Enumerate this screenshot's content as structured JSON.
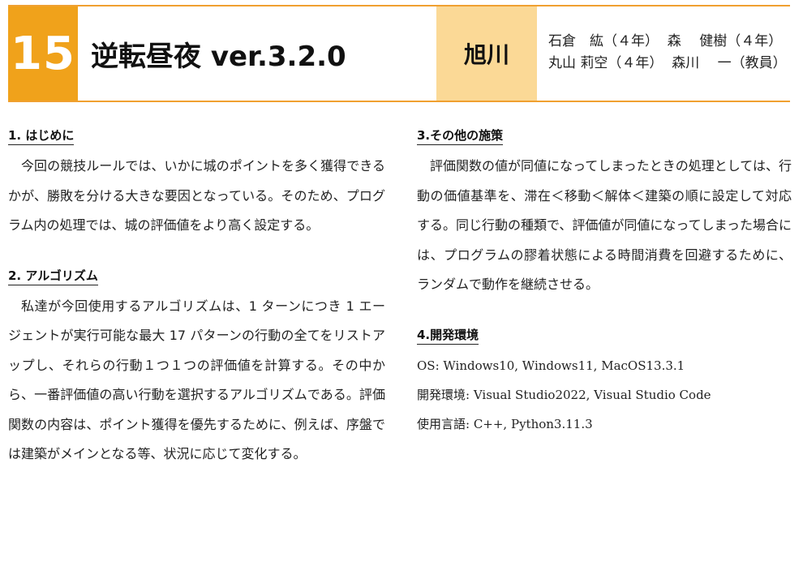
{
  "header": {
    "number": "15",
    "title": "逆転昼夜 ver.3.2.0",
    "school": "旭川",
    "members_line1": "石倉　紘（４年）  森　 健樹（４年）",
    "members_line2": "丸山 莉空（４年）  森川　 一（教員）"
  },
  "sections": {
    "intro": {
      "title": "1.  はじめに",
      "body": "今回の競技ルールでは、いかに城のポイントを多く獲得できるかが、勝敗を分ける大きな要因となっている。そのため、プログラム内の処理では、城の評価値をより高く設定する。"
    },
    "algorithm": {
      "title": "2.  アルゴリズム",
      "body": "私達が今回使用するアルゴリズムは、1 ターンにつき 1 エージェントが実行可能な最大 17 パターンの行動の全てをリストアップし、それらの行動１つ１つの評価値を計算する。その中から、一番評価値の高い行動を選択するアルゴリズムである。評価関数の内容は、ポイント獲得を優先するために、例えば、序盤では建築がメインとなる等、状況に応じて変化する。"
    },
    "other": {
      "title": "3.その他の施策",
      "body": "評価関数の値が同値になってしまったときの処理としては、行動の価値基準を、滞在＜移動＜解体＜建築の順に設定して対応する。同じ行動の種類で、評価値が同値になってしまった場合には、プログラムの膠着状態による時間消費を回避するために、ランダムで動作を継続させる。"
    },
    "environment": {
      "title": "4.開発環境",
      "os": "OS: Windows10, Windows11, MacOS13.3.1",
      "ide": "開発環境: Visual Studio2022, Visual Studio Code",
      "lang": "使用言語: C++, Python3.11.3"
    }
  },
  "colors": {
    "accent": "#f0a21b",
    "school_bg": "#fbd996",
    "rule": "#f0a030"
  }
}
